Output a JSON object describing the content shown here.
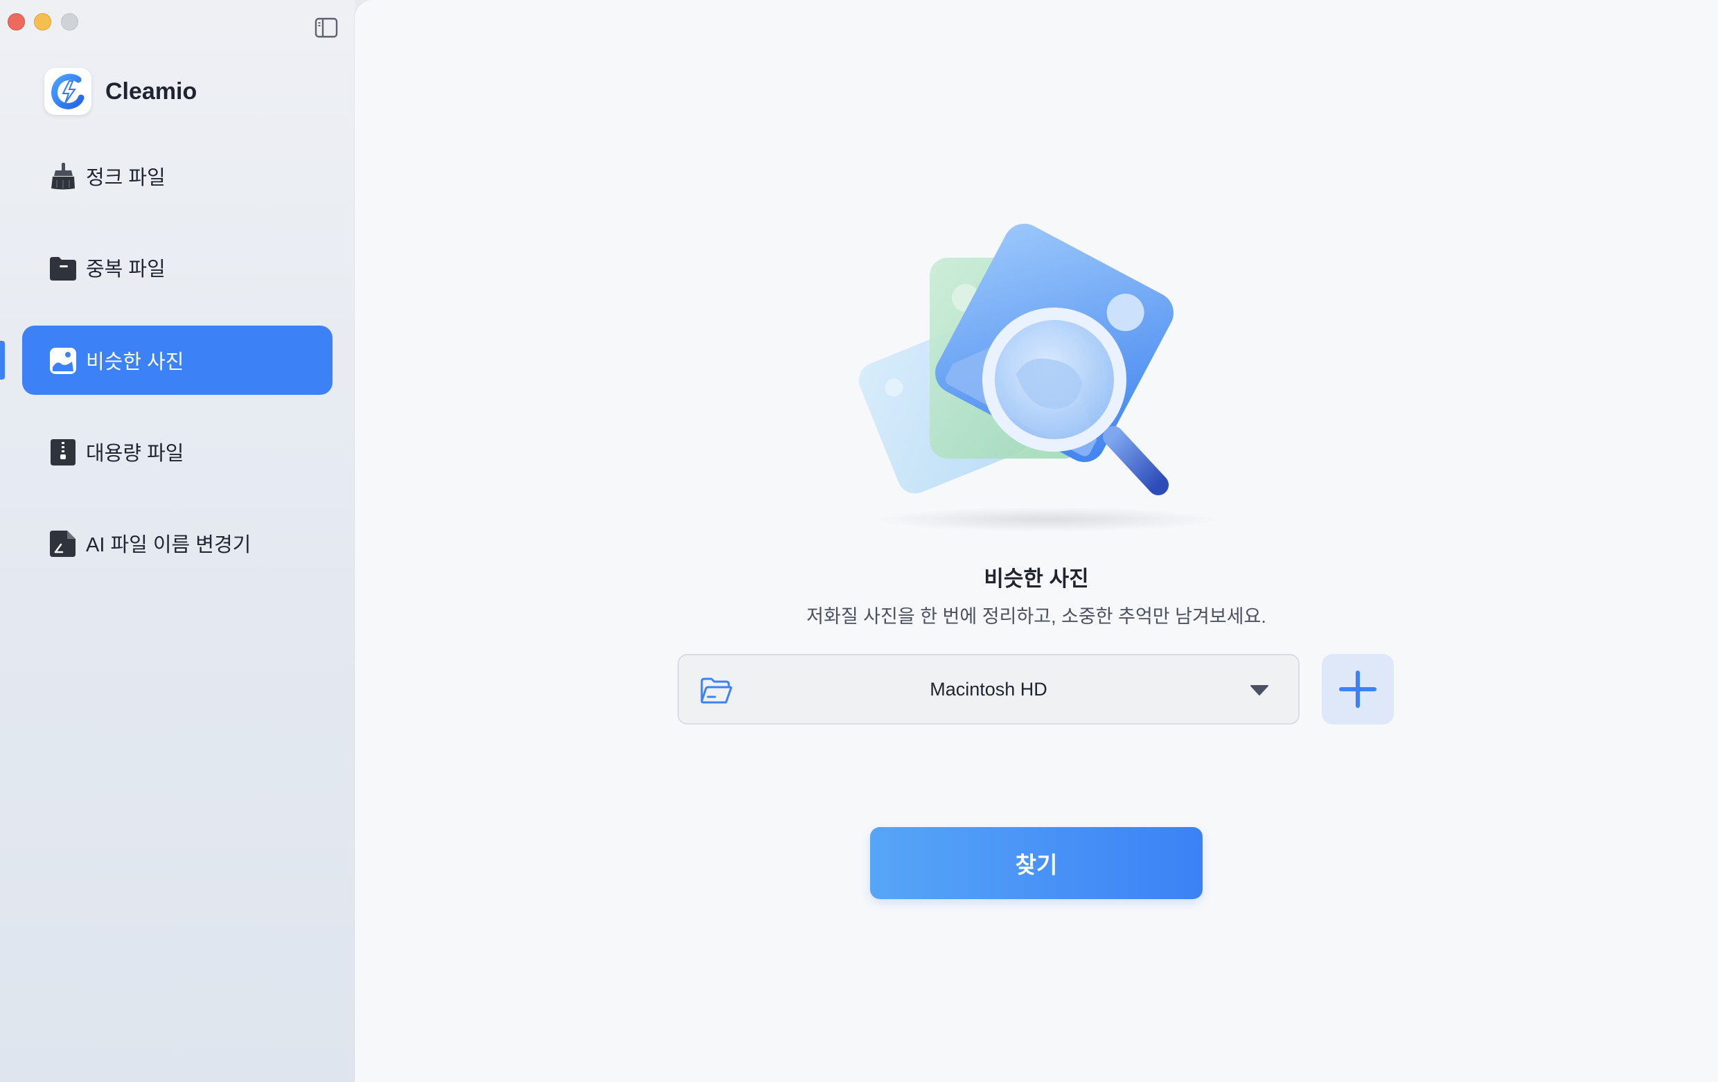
{
  "app": {
    "name": "Cleamio"
  },
  "sidebar": {
    "items": [
      {
        "label": "정크 파일",
        "icon": "broom-icon",
        "active": false
      },
      {
        "label": "중복 파일",
        "icon": "folder-icon",
        "active": false
      },
      {
        "label": "비슷한 사진",
        "icon": "photo-icon",
        "active": true
      },
      {
        "label": "대용량 파일",
        "icon": "zip-file-icon",
        "active": false
      },
      {
        "label": "AI 파일 이름 변경기",
        "icon": "rename-icon",
        "active": false
      }
    ]
  },
  "main": {
    "title": "비슷한 사진",
    "subtitle": "저화질 사진을 한 번에 정리하고, 소중한 추억만 남겨보세요.",
    "location": {
      "selected": "Macintosh HD"
    },
    "scan_label": "찾기"
  },
  "colors": {
    "accent": "#3c82f6",
    "accent_light": "#57a5f7",
    "add_button_bg": "#dfe8f8"
  }
}
